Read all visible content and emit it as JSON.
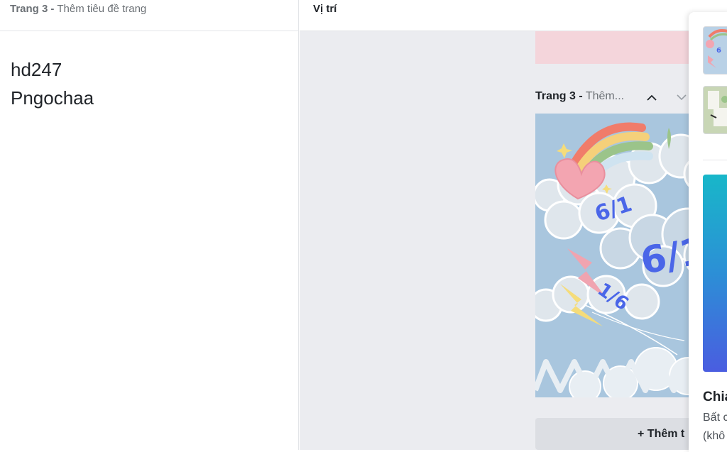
{
  "left_panel": {
    "header": {
      "page_number": "Trang 3",
      "separator": "-",
      "title_placeholder": "Thêm tiêu đề trang"
    },
    "notes": [
      "hd247",
      "Pngochaa"
    ]
  },
  "right_panel": {
    "header_label": "Vị trí",
    "page_label": {
      "page_number": "Trang 3 -",
      "title": "Thêm..."
    },
    "add_page_label": "+ Thêm t",
    "design": {
      "texts": [
        "6/1",
        "6/1",
        "1/6"
      ],
      "colors": {
        "background": "#a9c6de",
        "rainbow": [
          "#f07c6a",
          "#f5d07a",
          "#9bc48a",
          "#cfe3f0"
        ],
        "heart": "#f3a5b1",
        "lightning_pink": "#f0a4b0",
        "lightning_yellow": "#f5dc7a",
        "text_blue": "#4a66e8"
      }
    }
  },
  "share_popover": {
    "title": "Chia",
    "description_line1": "Bất c",
    "description_line2": "(khô"
  }
}
